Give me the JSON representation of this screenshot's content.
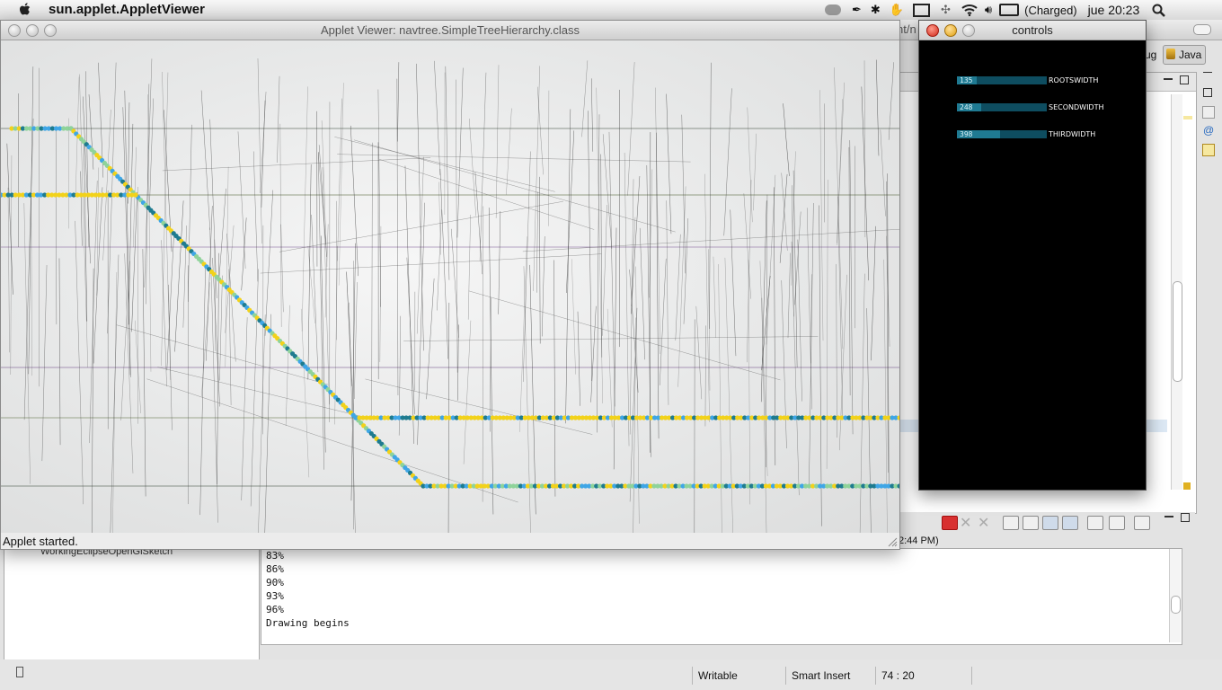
{
  "menubar": {
    "app_name": "sun.applet.AppletViewer",
    "battery": "(Charged)",
    "clock": "jue 20:23"
  },
  "applet_window": {
    "title": "Applet Viewer: navtree.SimpleTreeHierarchy.class",
    "status": "Applet started."
  },
  "controls_window": {
    "title": "controls",
    "sliders": [
      {
        "value": "135",
        "label": "ROOTSWIDTH",
        "fraction": 0.22
      },
      {
        "value": "248",
        "label": "SECONDWIDTH",
        "fraction": 0.27
      },
      {
        "value": "398",
        "label": "THIRDWIDTH",
        "fraction": 0.48
      }
    ]
  },
  "eclipse": {
    "behind_title_fragment": "nt/n",
    "perspective_fragment": "ug",
    "perspective_label": "Java",
    "console_header_fragment": "2:44 PM)",
    "project_fragment": "WorkingEclipseOpenGlSketch",
    "console_lines": [
      "83%",
      "86%",
      "90%",
      "93%",
      "96%",
      "Drawing begins"
    ],
    "status_writable": "Writable",
    "status_insert": "Smart Insert",
    "status_position": "74 : 20"
  },
  "colors": {
    "node_yellow": "#f2d21a",
    "node_blue": "#3fa6e6",
    "node_teal": "#1e7b8f",
    "node_green": "#8fd39a",
    "slider_bg": "#0e4d60",
    "slider_fill": "#1f7a92"
  },
  "icons": [
    "apple-icon",
    "spotlight-icon",
    "wifi-icon",
    "volume-icon",
    "battery-icon",
    "bluetooth-icon"
  ]
}
